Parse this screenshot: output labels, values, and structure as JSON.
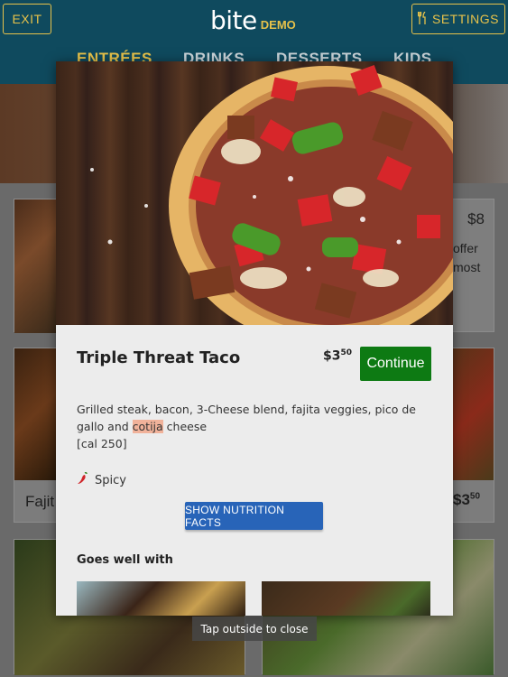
{
  "header": {
    "exit_label": "EXIT",
    "logo_text": "bite",
    "logo_badge": "DEMO",
    "settings_label": "SETTINGS",
    "tabs": [
      {
        "label": "ENTRÉES",
        "active": true
      },
      {
        "label": "DRINKS",
        "active": false
      },
      {
        "label": "DESSERTS",
        "active": false
      },
      {
        "label": "KIDS",
        "active": false
      }
    ]
  },
  "background_menu": {
    "card_right_top": {
      "price": "$8",
      "line1": "offer",
      "line2": "most"
    },
    "card_left_mid": {
      "name": "Fajit"
    },
    "card_right_mid": {
      "price_dollars": "$3",
      "price_cents": "50"
    }
  },
  "modal": {
    "title": "Triple Threat Taco",
    "price_dollars": "$3",
    "price_cents": "50",
    "continue_label": "Continue",
    "description_before": "Grilled steak, bacon, 3-Cheese blend, fajita veggies, pico de gallo and ",
    "description_highlight": "cotija",
    "description_after": " cheese",
    "calories": "[cal 250]",
    "spicy_label": "Spicy",
    "nutrition_button": "SHOW NUTRITION FACTS",
    "goes_well_with": "Goes well with"
  },
  "tap_hint": "Tap outside to close",
  "colors": {
    "header_bg": "#0f4a5e",
    "accent_gold": "#e7c24a",
    "continue_green": "#0d7a13",
    "nutrition_blue": "#2864b8",
    "highlight": "#f1b29a"
  }
}
